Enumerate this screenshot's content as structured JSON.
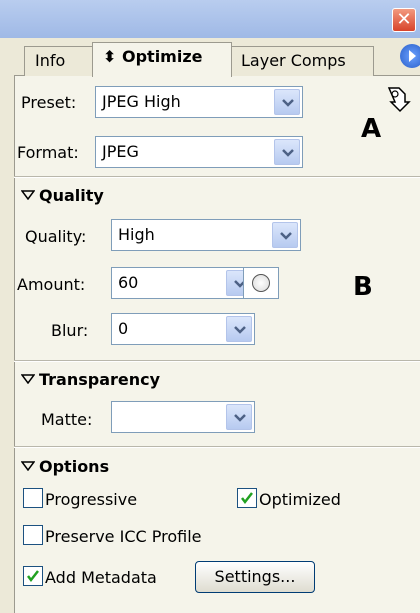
{
  "window": {
    "close_glyph": "✕"
  },
  "tabs": [
    {
      "label": "Info",
      "active": false
    },
    {
      "label": "Optimize",
      "active": true,
      "prefix": "⬍"
    },
    {
      "label": "Layer Comps",
      "active": false
    }
  ],
  "preset": {
    "label": "Preset:",
    "value": "JPEG High"
  },
  "format": {
    "label": "Format:",
    "value": "JPEG"
  },
  "annotations": {
    "a": "A",
    "b": "B"
  },
  "quality_section": {
    "title": "Quality",
    "quality": {
      "label": "Quality:",
      "value": "High"
    },
    "amount": {
      "label": "Amount:",
      "value": "60"
    },
    "blur": {
      "label": "Blur:",
      "value": "0"
    }
  },
  "transparency_section": {
    "title": "Transparency",
    "matte": {
      "label": "Matte:",
      "value": ""
    }
  },
  "options_section": {
    "title": "Options",
    "progressive": {
      "label": "Progressive",
      "checked": false
    },
    "optimized": {
      "label": "Optimized",
      "checked": true
    },
    "preserve_icc": {
      "label": "Preserve ICC Profile",
      "checked": false
    },
    "add_metadata": {
      "label": "Add Metadata",
      "checked": true
    },
    "settings_button": "Settings..."
  },
  "colors": {
    "accent": "#316AC5",
    "panel_bg": "#F5F4EA",
    "check": "#21A121"
  },
  "icons": [
    "close-icon",
    "panel-menu-icon",
    "export-wizard-icon",
    "dropdown-arrow-icon",
    "checkmark-icon",
    "disclosure-triangle-icon"
  ]
}
